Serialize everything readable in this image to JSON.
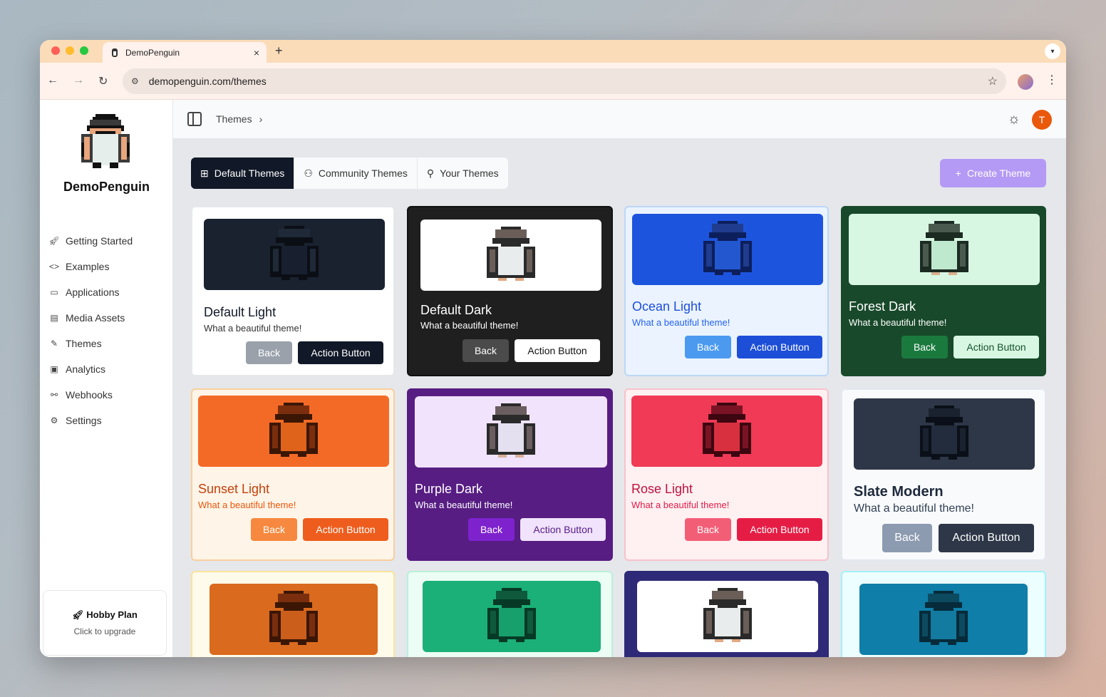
{
  "browser": {
    "tab_title": "DemoPenguin",
    "tab_close": "×",
    "new_tab": "+",
    "url": "demopenguin.com/themes"
  },
  "sidebar": {
    "brand": "DemoPenguin",
    "items": [
      {
        "label": "Getting Started",
        "icon": "rocket-icon"
      },
      {
        "label": "Examples",
        "icon": "code-icon"
      },
      {
        "label": "Applications",
        "icon": "window-icon"
      },
      {
        "label": "Media Assets",
        "icon": "file-image-icon"
      },
      {
        "label": "Themes",
        "icon": "brush-icon"
      },
      {
        "label": "Analytics",
        "icon": "monitor-chart-icon"
      },
      {
        "label": "Webhooks",
        "icon": "webhook-icon"
      },
      {
        "label": "Settings",
        "icon": "gear-icon"
      }
    ],
    "plan": {
      "title": "Hobby Plan",
      "subtitle": "Click to upgrade"
    }
  },
  "header": {
    "breadcrumb": "Themes",
    "avatar_letter": "T"
  },
  "tabs": [
    {
      "label": "Default Themes",
      "icon": "grid-icon"
    },
    {
      "label": "Community Themes",
      "icon": "users-icon"
    },
    {
      "label": "Your Themes",
      "icon": "user-icon"
    }
  ],
  "create_button": "Create Theme",
  "themes": [
    {
      "name": "Default Light",
      "subtitle": "What a beautiful theme!",
      "back": "Back",
      "action": "Action Button",
      "colors": {
        "card": "#ffffff",
        "border": "#e5e7eb",
        "preview": "#1a2230",
        "title": "#111827",
        "sub": "#333333",
        "back_bg": "#9aa1ab",
        "back_fg": "#ffffff",
        "act_bg": "#111827",
        "act_fg": "#ffffff",
        "p_dark": "#0b0f15",
        "p_mid": "#1f2937",
        "p_belly": "#182030",
        "p_feet": "#0b0f15"
      }
    },
    {
      "name": "Default Dark",
      "subtitle": "What a beautiful theme!",
      "back": "Back",
      "action": "Action Button",
      "colors": {
        "card": "#1f1f1f",
        "border": "#111111",
        "preview": "#ffffff",
        "title": "#ffffff",
        "sub": "#ffffff",
        "back_bg": "#4b4b4b",
        "back_fg": "#ffffff",
        "act_bg": "#ffffff",
        "act_fg": "#111111",
        "p_dark": "#2a2a2a",
        "p_mid": "#6b5e58",
        "p_belly": "#e8ecec",
        "p_feet": "#e0a882"
      }
    },
    {
      "name": "Ocean Light",
      "subtitle": "What a beautiful theme!",
      "back": "Back",
      "action": "Action Button",
      "colors": {
        "card": "#eaf3ff",
        "border": "#bcd7f7",
        "preview": "#1d54dd",
        "title": "#1d4ed8",
        "sub": "#2563eb",
        "back_bg": "#4b9af0",
        "back_fg": "#ffffff",
        "act_bg": "#1d4ed8",
        "act_fg": "#ffffff",
        "p_dark": "#0c1f5c",
        "p_mid": "#1f3c8f",
        "p_belly": "#2357d0",
        "p_feet": "#0c1f5c"
      }
    },
    {
      "name": "Forest Dark",
      "subtitle": "What a beautiful theme!",
      "back": "Back",
      "action": "Action Button",
      "colors": {
        "card": "#18492a",
        "border": "#18492a",
        "preview": "#d8f7e3",
        "title": "#ffffff",
        "sub": "#ffffff",
        "back_bg": "#1a7a3e",
        "back_fg": "#ffffff",
        "act_bg": "#d8f7e3",
        "act_fg": "#14532d",
        "p_dark": "#1b2b22",
        "p_mid": "#4a5a4e",
        "p_belly": "#bfe9cf",
        "p_feet": "#d9b08e"
      }
    },
    {
      "name": "Sunset Light",
      "subtitle": "What a beautiful theme!",
      "back": "Back",
      "action": "Action Button",
      "colors": {
        "card": "#fff4e8",
        "border": "#f9cf9d",
        "preview": "#f36a26",
        "title": "#c2410c",
        "sub": "#ea580c",
        "back_bg": "#f6893f",
        "back_fg": "#ffffff",
        "act_bg": "#ee5d1d",
        "act_fg": "#ffffff",
        "p_dark": "#3b1605",
        "p_mid": "#7a2e0e",
        "p_belly": "#e0631c",
        "p_feet": "#3b1605"
      }
    },
    {
      "name": "Purple Dark",
      "subtitle": "What a beautiful theme!",
      "back": "Back",
      "action": "Action Button",
      "colors": {
        "card": "#571d83",
        "border": "#571d83",
        "preview": "#f0e3fb",
        "title": "#ffffff",
        "sub": "#ffffff",
        "back_bg": "#7e22ce",
        "back_fg": "#ffffff",
        "act_bg": "#f0e3fb",
        "act_fg": "#581c87",
        "p_dark": "#2a2a2a",
        "p_mid": "#6b5e60",
        "p_belly": "#e4e0f0",
        "p_feet": "#d9b09a"
      }
    },
    {
      "name": "Rose Light",
      "subtitle": "What a beautiful theme!",
      "back": "Back",
      "action": "Action Button",
      "colors": {
        "card": "#fff0f2",
        "border": "#f8c2cb",
        "preview": "#f03a56",
        "title": "#be123c",
        "sub": "#e11d48",
        "back_bg": "#f35e77",
        "back_fg": "#ffffff",
        "act_bg": "#e51d45",
        "act_fg": "#ffffff",
        "p_dark": "#3d0610",
        "p_mid": "#7a1424",
        "p_belly": "#d8303f",
        "p_feet": "#3d0610"
      }
    },
    {
      "name": "Slate Modern",
      "subtitle": "What a beautiful theme!",
      "back": "Back",
      "action": "Action Button",
      "colors": {
        "card": "#f8fafc",
        "border": "#e2e8f0",
        "preview": "#2d3748",
        "title": "#1e293b",
        "sub": "#334155",
        "back_bg": "#8c9bb0",
        "back_fg": "#ffffff",
        "act_bg": "#2d3748",
        "act_fg": "#ffffff",
        "p_dark": "#0b1018",
        "p_mid": "#1a2230",
        "p_belly": "#222c3c",
        "p_feet": "#0b1018"
      }
    },
    {
      "name": "",
      "subtitle": "",
      "back": "",
      "action": "",
      "colors": {
        "card": "#fffbea",
        "border": "#fbe39a",
        "preview": "#d96a1e",
        "title": "#000",
        "sub": "#000",
        "back_bg": "#000",
        "back_fg": "#fff",
        "act_bg": "#000",
        "act_fg": "#fff",
        "p_dark": "#3b1605",
        "p_mid": "#7a2e0e",
        "p_belly": "#cc5e1c",
        "p_feet": "#3b1605"
      }
    },
    {
      "name": "",
      "subtitle": "",
      "back": "",
      "action": "",
      "colors": {
        "card": "#ecfdf5",
        "border": "#b9f0d8",
        "preview": "#1bb077",
        "title": "#000",
        "sub": "#000",
        "back_bg": "#000",
        "back_fg": "#fff",
        "act_bg": "#000",
        "act_fg": "#fff",
        "p_dark": "#063a26",
        "p_mid": "#0f5a3c",
        "p_belly": "#18a06c",
        "p_feet": "#063a26"
      }
    },
    {
      "name": "",
      "subtitle": "",
      "back": "",
      "action": "",
      "colors": {
        "card": "#2e2a78",
        "border": "#2e2a78",
        "preview": "#ffffff",
        "title": "#fff",
        "sub": "#fff",
        "back_bg": "#000",
        "back_fg": "#fff",
        "act_bg": "#000",
        "act_fg": "#fff",
        "p_dark": "#2a2a2a",
        "p_mid": "#6b5e58",
        "p_belly": "#e8ecec",
        "p_feet": "#e0a882"
      }
    },
    {
      "name": "",
      "subtitle": "",
      "back": "",
      "action": "",
      "colors": {
        "card": "#ecfeff",
        "border": "#a5f0fb",
        "preview": "#0f7ea8",
        "title": "#000",
        "sub": "#000",
        "back_bg": "#000",
        "back_fg": "#fff",
        "act_bg": "#000",
        "act_fg": "#fff",
        "p_dark": "#062b3a",
        "p_mid": "#0c4a60",
        "p_belly": "#137aa0",
        "p_feet": "#062b3a"
      }
    }
  ]
}
